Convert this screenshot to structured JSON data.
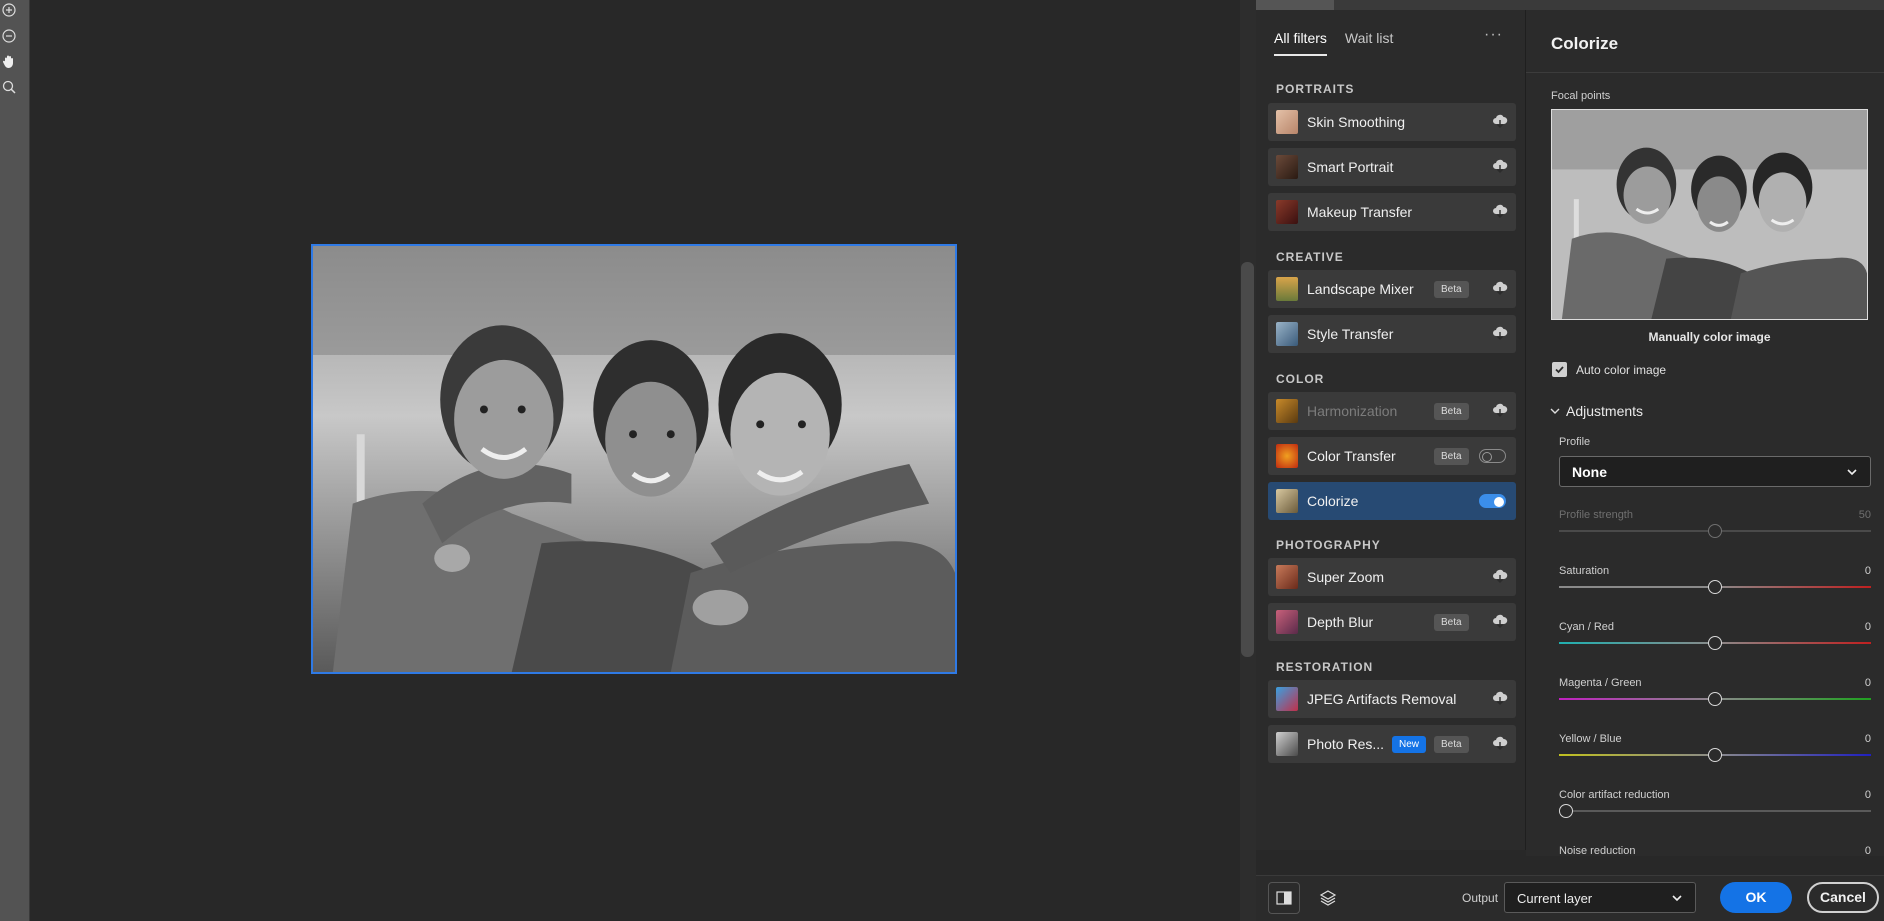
{
  "toolbar": {
    "tools": [
      {
        "icon": "zoom-in-icon"
      },
      {
        "icon": "zoom-out-icon"
      },
      {
        "icon": "hand-icon"
      },
      {
        "icon": "magnifier-icon"
      }
    ]
  },
  "filters_panel": {
    "tabs": [
      {
        "label": "All filters",
        "active": true
      },
      {
        "label": "Wait list",
        "active": false
      }
    ],
    "more_label": "···",
    "sections": {
      "portraits": "PORTRAITS",
      "creative": "CREATIVE",
      "color": "COLOR",
      "photography": "PHOTOGRAPHY",
      "restoration": "RESTORATION"
    },
    "items": {
      "skin_smoothing": {
        "label": "Skin Smoothing",
        "action": "cloud-download-icon"
      },
      "smart_portrait": {
        "label": "Smart Portrait",
        "action": "cloud-download-icon"
      },
      "makeup_transfer": {
        "label": "Makeup Transfer",
        "action": "cloud-download-icon"
      },
      "landscape_mixer": {
        "label": "Landscape Mixer",
        "badge": "Beta",
        "action": "cloud-download-icon"
      },
      "style_transfer": {
        "label": "Style Transfer",
        "action": "cloud-download-icon"
      },
      "harmonization": {
        "label": "Harmonization",
        "badge": "Beta",
        "action": "cloud-download-icon",
        "disabled": true
      },
      "color_transfer": {
        "label": "Color Transfer",
        "badge": "Beta",
        "toggle": false
      },
      "colorize": {
        "label": "Colorize",
        "toggle": true,
        "selected": true
      },
      "super_zoom": {
        "label": "Super Zoom",
        "action": "cloud-download-icon"
      },
      "depth_blur": {
        "label": "Depth Blur",
        "badge": "Beta",
        "action": "cloud-download-icon"
      },
      "jpeg_artifacts": {
        "label": "JPEG Artifacts Removal",
        "action": "cloud-download-icon"
      },
      "photo_restoration": {
        "label": "Photo Res...",
        "badge_new": "New",
        "badge": "Beta",
        "action": "cloud-download-icon"
      }
    }
  },
  "properties": {
    "title": "Colorize",
    "focal_points_label": "Focal points",
    "preview_caption": "Manually color image",
    "auto_color": {
      "label": "Auto color image",
      "checked": true
    },
    "adjustments_label": "Adjustments",
    "profile": {
      "label": "Profile",
      "value": "None"
    },
    "sliders": {
      "profile_strength": {
        "label": "Profile strength",
        "value": "50",
        "disabled": true,
        "level": 0.5
      },
      "saturation": {
        "label": "Saturation",
        "value": "0",
        "level": 0.5
      },
      "cyan_red": {
        "label": "Cyan / Red",
        "value": "0",
        "level": 0.5
      },
      "magenta_green": {
        "label": "Magenta / Green",
        "value": "0",
        "level": 0.5
      },
      "yellow_blue": {
        "label": "Yellow / Blue",
        "value": "0",
        "level": 0.5
      },
      "color_artifact": {
        "label": "Color artifact reduction",
        "value": "0",
        "level": 0.0
      },
      "noise_reduction": {
        "label": "Noise reduction",
        "value": "0"
      }
    }
  },
  "bottom": {
    "output_label": "Output",
    "output_value": "Current layer",
    "ok_label": "OK",
    "cancel_label": "Cancel"
  },
  "colors": {
    "accent": "#1473e6",
    "selected_row": "#274a73",
    "panel": "#2b2b2b",
    "canvas": "#282828"
  }
}
